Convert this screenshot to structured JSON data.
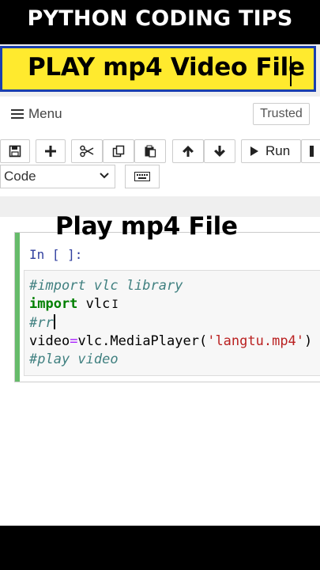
{
  "banner": {
    "title": "PYTHON CODING TIPS"
  },
  "caption": {
    "text": "PLAY mp4 Video File"
  },
  "menubar": {
    "menu_label": "Menu",
    "trusted_label": "Trusted"
  },
  "toolbar": {
    "run_label": "Run",
    "cell_type_selected": "Code",
    "buttons": [
      "save-icon",
      "plus-icon",
      "scissors-icon",
      "copy-icon",
      "paste-icon",
      "arrow-up-icon",
      "arrow-down-icon",
      "run-icon",
      "stop-icon",
      "keyboard-icon"
    ]
  },
  "notebook": {
    "heading": "Play mp4 File",
    "prompt": "In [ ]:",
    "code": {
      "line1_comment": "#import vlc library",
      "line2_kw": "import",
      "line2_rest": " vlc",
      "line3_comment": "#rr",
      "line4_var": "video",
      "line4_op": "=",
      "line4_call": "vlc.MediaPlayer(",
      "line4_str": "'langtu.mp4'",
      "line4_end": ")",
      "line5_comment": "#play video"
    }
  },
  "colors": {
    "highlight": "#ffea2e",
    "highlight_border": "#1a3fae",
    "cell_selected": "#66bb6a",
    "prompt": "#303f9f"
  }
}
